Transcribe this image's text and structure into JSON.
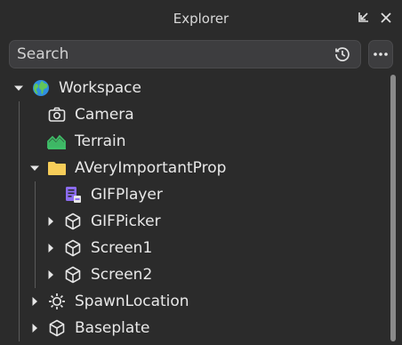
{
  "panel": {
    "title": "Explorer"
  },
  "search": {
    "placeholder": "Search",
    "value": ""
  },
  "tree": {
    "workspace": "Workspace",
    "camera": "Camera",
    "terrain": "Terrain",
    "prop": "AVeryImportantProp",
    "gifplayer": "GIFPlayer",
    "gifpicker": "GIFPicker",
    "screen1": "Screen1",
    "screen2": "Screen2",
    "spawn": "SpawnLocation",
    "baseplate": "Baseplate"
  },
  "icons": {
    "workspace": "globe-icon",
    "camera": "camera-icon",
    "terrain": "terrain-icon",
    "folder": "folder-icon",
    "script": "local-script-icon",
    "part": "cube-icon",
    "spawn": "spawn-location-icon"
  },
  "colors": {
    "background": "#2b2b2b",
    "folder": "#f6cd59",
    "terrain": "#3fbf68",
    "script": "#8c6cf0",
    "globe_blue": "#2f8fe0",
    "globe_green": "#62c55a"
  }
}
